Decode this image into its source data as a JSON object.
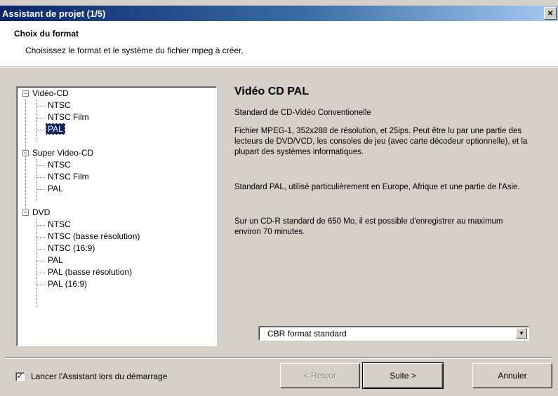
{
  "window": {
    "title": "Assistant de projet (1/5)",
    "close_glyph": "×"
  },
  "header": {
    "title": "Choix du format",
    "subtitle": "Choisissez le format et le système du fichier mpeg à créer."
  },
  "tree": {
    "groups": [
      {
        "label": "Vidéo-CD",
        "expander": "−",
        "items": [
          "NTSC",
          "NTSC Film",
          "PAL"
        ]
      },
      {
        "label": "Super Video-CD",
        "expander": "−",
        "items": [
          "NTSC",
          "NTSC Film",
          "PAL"
        ]
      },
      {
        "label": "DVD",
        "expander": "−",
        "items": [
          "NTSC",
          "NTSC (basse résolution)",
          "NTSC (16:9)",
          "PAL",
          "PAL (basse résolution)",
          "PAL (16:9)"
        ]
      }
    ],
    "selected": "Vidéo-CD / PAL"
  },
  "info": {
    "title": "Vidéo CD PAL",
    "p1": "Standard de CD-Vidéo Conventionelle",
    "p2": "Fichier MPEG-1, 352x288 de résolution, et 25ips. Peut être lu par une partie des lecteurs de DVD/VCD, les consoles de jeu (avec carte décodeur optionnelle), et la plupart des systèmes informatiques.",
    "p3": "Standard PAL, utilisé particulièrement en Europe, Afrique et une partie de l'Asie.",
    "p4": "Sur un CD-R standard de 650 Mo, il est possible d'enregistrer au maximum environ 70 minutes."
  },
  "combo": {
    "value": "CBR format standard",
    "arrow": "▼"
  },
  "footer": {
    "checkbox_label": "Lancer l'Assistant lors du démarrage",
    "checkbox_checked": true,
    "check_glyph": "✓",
    "back_button": "< Retour",
    "next_button": "Suite >",
    "cancel_button": "Annuler"
  },
  "colors": {
    "titlebar": "#0a246a",
    "face": "#d4d0c8",
    "selection": "#0a246a"
  },
  "icons": [
    "close-icon",
    "tree-expander-icon",
    "combo-arrow-icon",
    "checkmark-icon"
  ]
}
